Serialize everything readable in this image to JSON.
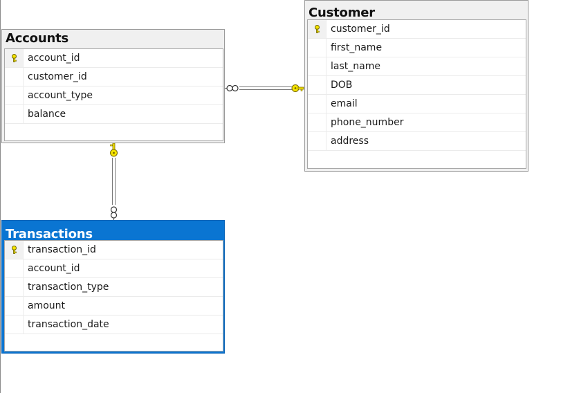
{
  "tables": {
    "accounts": {
      "title": "Accounts",
      "columns": [
        {
          "name": "account_id",
          "primary_key": true
        },
        {
          "name": "customer_id",
          "primary_key": false
        },
        {
          "name": "account_type",
          "primary_key": false
        },
        {
          "name": "balance",
          "primary_key": false
        }
      ]
    },
    "customer": {
      "title": "Customer",
      "columns": [
        {
          "name": "customer_id",
          "primary_key": true
        },
        {
          "name": "first_name",
          "primary_key": false
        },
        {
          "name": "last_name",
          "primary_key": false
        },
        {
          "name": "DOB",
          "primary_key": false
        },
        {
          "name": "email",
          "primary_key": false
        },
        {
          "name": "phone_number",
          "primary_key": false
        },
        {
          "name": "address",
          "primary_key": false
        }
      ]
    },
    "transactions": {
      "title": "Transactions",
      "selected": true,
      "columns": [
        {
          "name": "transaction_id",
          "primary_key": true
        },
        {
          "name": "account_id",
          "primary_key": false
        },
        {
          "name": "transaction_type",
          "primary_key": false
        },
        {
          "name": "amount",
          "primary_key": false
        },
        {
          "name": "transaction_date",
          "primary_key": false
        }
      ]
    }
  },
  "relationships": [
    {
      "from": "accounts",
      "to": "customer",
      "one_side": "customer",
      "many_side": "accounts"
    },
    {
      "from": "transactions",
      "to": "accounts",
      "one_side": "accounts",
      "many_side": "transactions"
    }
  ],
  "colors": {
    "selected_header": "#0a75d2",
    "header_gray": "#f0f0f0",
    "key_yellow": "#f5e400",
    "line_gray": "#7a7a7a"
  }
}
